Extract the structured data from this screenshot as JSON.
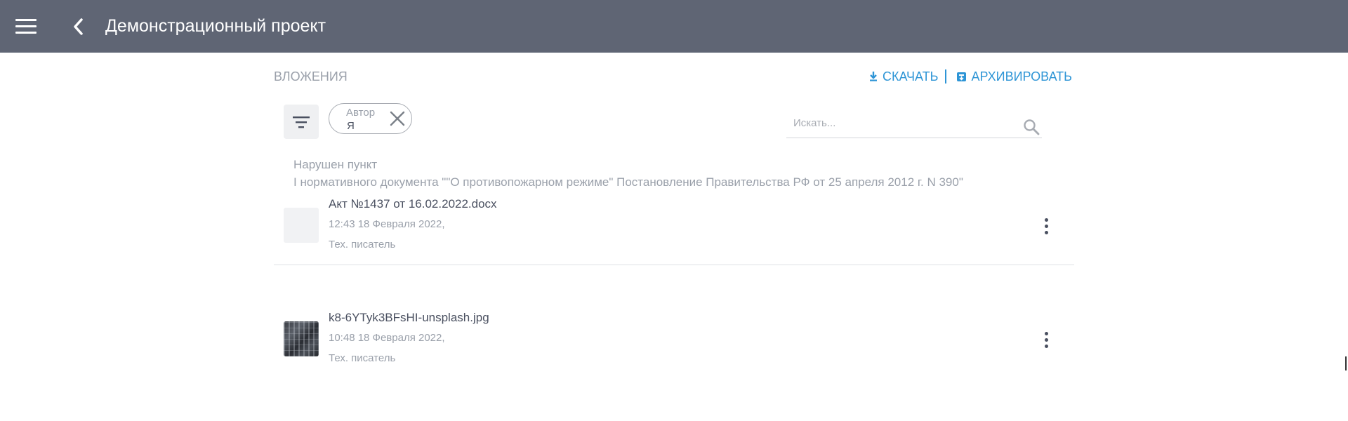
{
  "header": {
    "title": "Демонстрационный проект",
    "menu_icon": "hamburger-menu-icon",
    "back_icon": "chevron-left-icon"
  },
  "attachments_section": {
    "title": "ВЛОЖЕНИЯ",
    "download_label": "СКАЧАТЬ",
    "archive_label": "АРХИВИРОВАТЬ"
  },
  "filters": {
    "filter_icon": "filter-icon",
    "chip": {
      "label": "Автор",
      "value": "Я"
    }
  },
  "search": {
    "placeholder": "Искать...",
    "value": ""
  },
  "violation": {
    "title": "Нарушен пункт",
    "text": "I нормативного документа \"\"О противопожарном режиме\" Постановление Правительства РФ от 25 апреля 2012 г. N 390\""
  },
  "attachments": [
    {
      "name": "Акт №1437 от 16.02.2022.docx",
      "date": "12:43 18 Февраля 2022,",
      "author": "Тех. писатель"
    },
    {
      "name": "k8-6YTyk3BFsHI-unsplash.jpg",
      "date": "10:48 18 Февраля 2022,",
      "author": "Тех. писатель"
    }
  ],
  "colors": {
    "topbar": "#5f6574",
    "accent": "#2e95d6",
    "muted_text": "#9aa0aa",
    "primary_text": "#4a5060"
  }
}
